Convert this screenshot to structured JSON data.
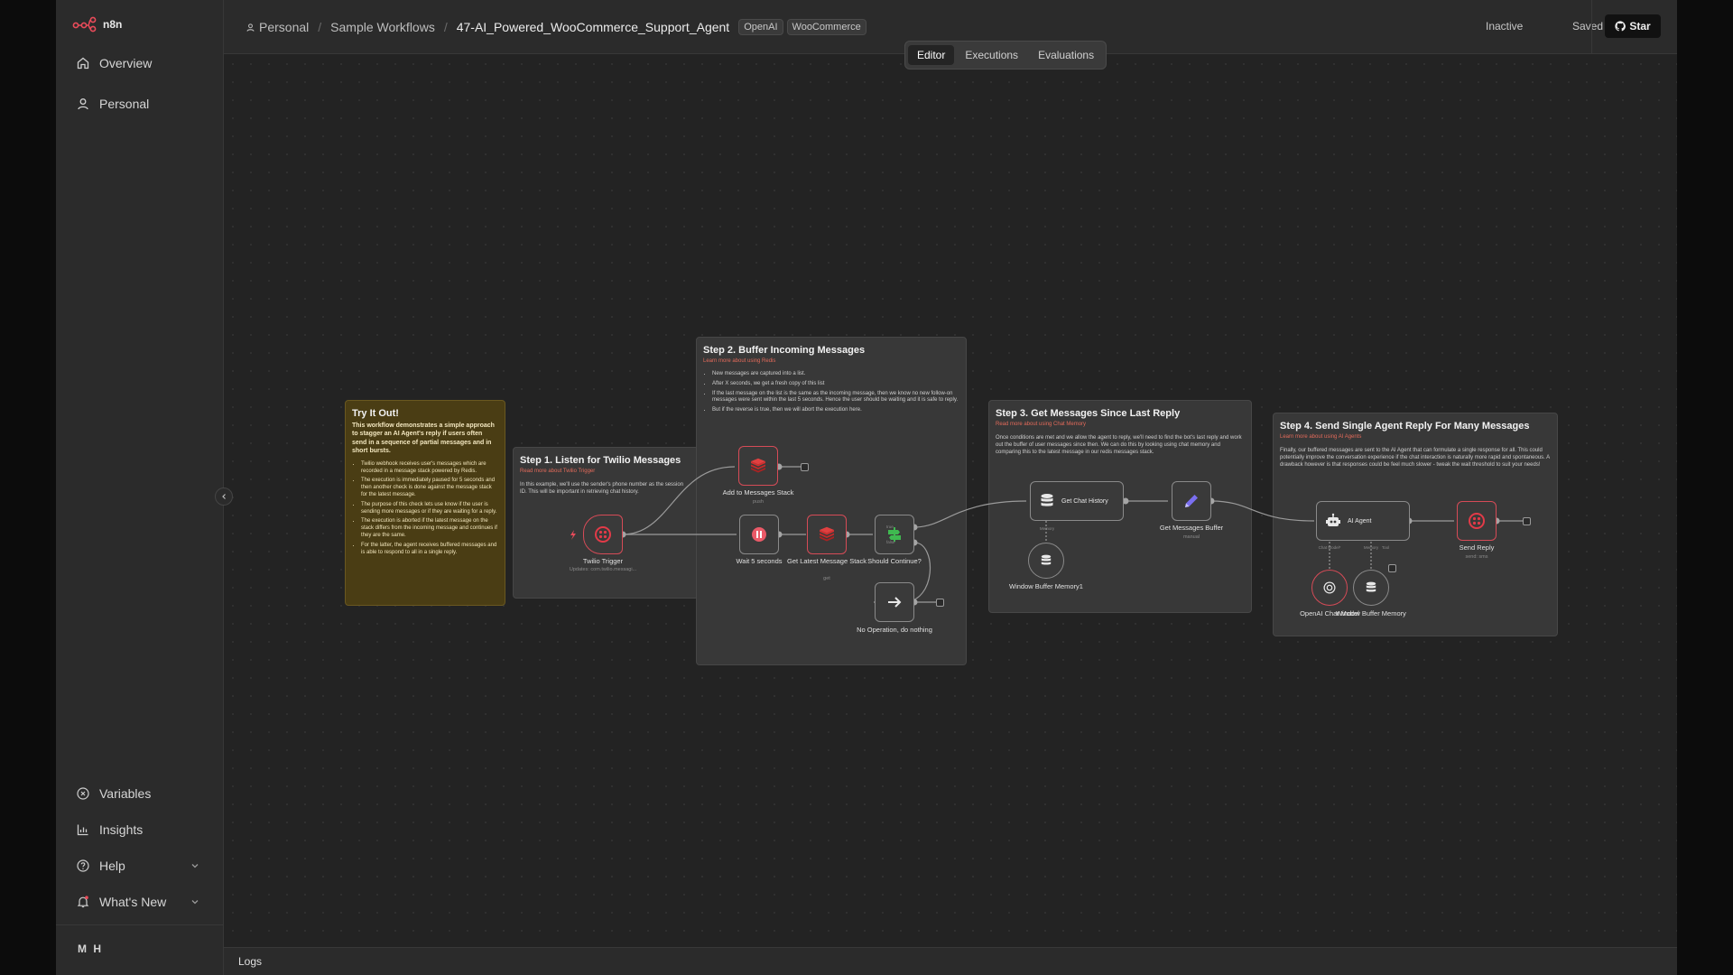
{
  "app": {
    "name": "n8n"
  },
  "sidebar": {
    "items": [
      {
        "label": "Overview",
        "icon": "home-icon"
      },
      {
        "label": "Personal",
        "icon": "user-icon"
      }
    ],
    "bottom_items": [
      {
        "label": "Variables",
        "icon": "variables-icon"
      },
      {
        "label": "Insights",
        "icon": "chart-icon"
      },
      {
        "label": "Help",
        "icon": "help-icon"
      },
      {
        "label": "What's New",
        "icon": "bell-icon"
      }
    ],
    "user_initials": "M H"
  },
  "header": {
    "breadcrumbs": [
      "Personal",
      "Sample Workflows",
      "47-AI_Powered_WooCommerce_Support_Agent"
    ],
    "tags": [
      "OpenAI",
      "WooCommerce"
    ],
    "status": "Inactive",
    "saved": "Saved",
    "star_label": "Star",
    "tabs": [
      "Editor",
      "Executions",
      "Evaluations"
    ],
    "active_tab": "Editor"
  },
  "stickies": {
    "try": {
      "title": "Try It Out!",
      "intro": "This workflow demonstrates a simple approach to stagger an AI Agent's reply if users often send in a sequence of partial messages and in short bursts.",
      "bullets": [
        "Twilio webhook receives user's messages which are recorded in a message stack powered by Redis.",
        "The execution is immediately paused for 5 seconds and then another check is done against the message stack for the latest message.",
        "The purpose of this check lets use know if the user is sending more messages or if they are waiting for a reply.",
        "The execution is aborted if the latest message on the stack differs from the incoming message and continues if they are the same.",
        "For the latter, the agent receives buffered messages and is able to respond to all in a single reply."
      ]
    },
    "step1": {
      "title": "Step 1. Listen for Twilio Messages",
      "link": "Read more about Twilio Trigger",
      "body": "In this example, we'll use the sender's phone number as the session ID. This will be important in retrieving chat history."
    },
    "step2": {
      "title": "Step 2. Buffer Incoming Messages",
      "link": "Learn more about using Redis",
      "bullets": [
        "New messages are captured into a list.",
        "After X seconds, we get a fresh copy of this list",
        "If the last message on the list is the same as the incoming message, then we know no new follow-on messages were sent within the last 5 seconds. Hence the user should be waiting and it is safe to reply.",
        "But if the reverse is true, then we will abort the execution here."
      ]
    },
    "step3": {
      "title": "Step 3. Get Messages Since Last Reply",
      "link": "Read more about using Chat Memory",
      "body": "Once conditions are met and we allow the agent to reply, we'll need to find the bot's last reply and work out the buffer of user messages since then. We can do this by looking using chat memory and comparing this to the latest message in our redis messages stack."
    },
    "step4": {
      "title": "Step 4. Send Single Agent Reply For Many Messages",
      "link": "Learn more about using AI Agents",
      "body": "Finally, our buffered messages are sent to the AI Agent that can formulate a single response for all. This could potentially improve the conversation experience if the chat interaction is naturally more rapid and spontaneous. A drawback however is that responses could be feel much slower - tweak the wait threshold to suit your needs!"
    }
  },
  "nodes": {
    "twilio_trigger": {
      "label": "Twilio Trigger",
      "sub": "Updates: com.twilio.messagi..."
    },
    "add_stack": {
      "label": "Add to Messages Stack",
      "sub": "push"
    },
    "wait": {
      "label": "Wait 5 seconds"
    },
    "get_latest": {
      "label": "Get Latest Message Stack",
      "sub": "get"
    },
    "should_continue": {
      "label": "Should Continue?",
      "true_label": "true",
      "false_label": "false"
    },
    "noop": {
      "label": "No Operation, do nothing"
    },
    "get_history": {
      "label": "Get Chat History",
      "memory_label": "Memory"
    },
    "window_mem1": {
      "label": "Window Buffer Memory1"
    },
    "get_buffer": {
      "label": "Get Messages Buffer",
      "sub": "manual"
    },
    "ai_agent": {
      "label": "AI Agent",
      "port_model": "Chat Model*",
      "port_memory": "Memory",
      "port_tool": "Tool"
    },
    "openai_model": {
      "label": "OpenAI Chat Model"
    },
    "window_mem": {
      "label": "Window Buffer Memory"
    },
    "send_reply": {
      "label": "Send Reply",
      "sub": "send: sms"
    }
  },
  "footer": {
    "logs_label": "Logs"
  },
  "colors": {
    "accent": "#ea4b5a",
    "redis": "#d62e2e",
    "if_green": "#3fb950",
    "sticky_yellow": "#4a3d14",
    "set_purple": "#7a6ff0"
  }
}
